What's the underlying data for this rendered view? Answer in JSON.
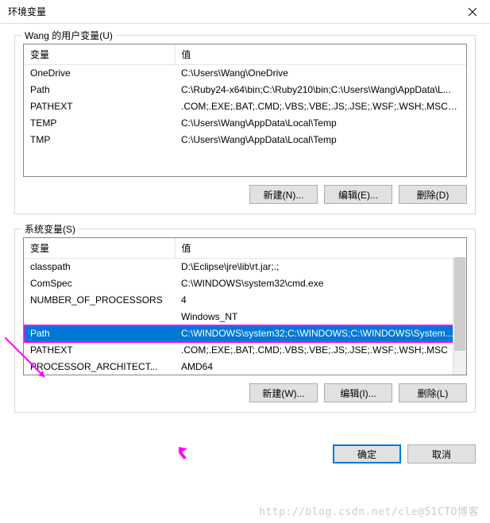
{
  "titlebar": {
    "title": "环境变量"
  },
  "user_section": {
    "legend": "Wang 的用户变量(U)",
    "headers": {
      "name": "变量",
      "value": "值"
    },
    "rows": [
      {
        "name": "OneDrive",
        "value": "C:\\Users\\Wang\\OneDrive"
      },
      {
        "name": "Path",
        "value": "C:\\Ruby24-x64\\bin;C:\\Ruby210\\bin;C:\\Users\\Wang\\AppData\\L..."
      },
      {
        "name": "PATHEXT",
        "value": ".COM;.EXE;.BAT;.CMD;.VBS;.VBE;.JS;.JSE;.WSF;.WSH;.MSC;.RB;..."
      },
      {
        "name": "TEMP",
        "value": "C:\\Users\\Wang\\AppData\\Local\\Temp"
      },
      {
        "name": "TMP",
        "value": "C:\\Users\\Wang\\AppData\\Local\\Temp"
      }
    ],
    "buttons": {
      "new": "新建(N)...",
      "edit": "编辑(E)...",
      "delete": "删除(D)"
    }
  },
  "system_section": {
    "legend": "系统变量(S)",
    "headers": {
      "name": "变量",
      "value": "值"
    },
    "rows": [
      {
        "name": "classpath",
        "value": "D:\\Eclipse\\jre\\lib\\rt.jar;.;"
      },
      {
        "name": "ComSpec",
        "value": "C:\\WINDOWS\\system32\\cmd.exe"
      },
      {
        "name": "NUMBER_OF_PROCESSORS",
        "value": "4"
      },
      {
        "name": "",
        "value": "Windows_NT"
      },
      {
        "name": "Path",
        "value": "C:\\WINDOWS\\system32;C:\\WINDOWS;C:\\WINDOWS\\System...",
        "selected": true
      },
      {
        "name": "PATHEXT",
        "value": ".COM;.EXE;.BAT;.CMD;.VBS;.VBE;.JS;.JSE;.WSF;.WSH;.MSC"
      },
      {
        "name": "PROCESSOR_ARCHITECT...",
        "value": "AMD64"
      }
    ],
    "buttons": {
      "new": "新建(W)...",
      "edit": "编辑(I)...",
      "delete": "删除(L)"
    }
  },
  "footer": {
    "ok": "确定",
    "cancel": "取消"
  },
  "watermark": "http://blog.csdn.net/cle@51CTO博客"
}
